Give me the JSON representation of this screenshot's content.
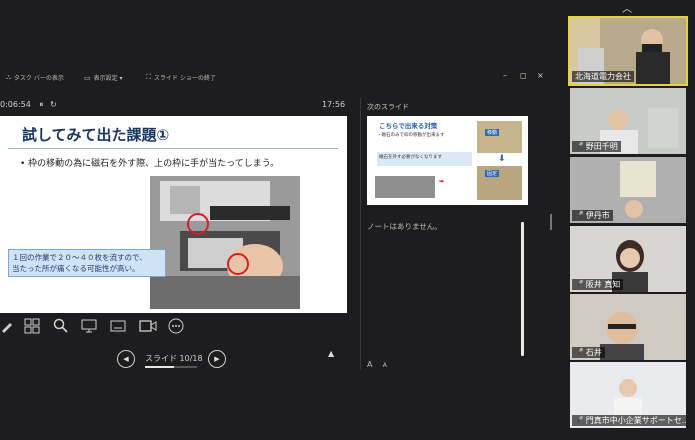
{
  "toolbar": {
    "taskbar_label": "タスク バーの表示",
    "display_settings_label": "表示設定 ▾",
    "end_show_label": "スライド ショーの終了",
    "win_min": "–",
    "win_restore": "◻",
    "win_close": "×"
  },
  "timer": {
    "elapsed_time": "0:06:54",
    "clock": "17:56"
  },
  "slide": {
    "title": "試してみて出た課題①",
    "bullet": "• 枠の移動の為に磁石を外す際、上の枠に手が当たってしまう。",
    "caption_line1": "１回の作業で２０～４０枚を流すので、",
    "caption_line2": "当たった所が痛くなる可能性が高い。"
  },
  "navigation": {
    "slide_indicator": "スライド 10/18",
    "current": 10,
    "total": 18
  },
  "next_slide": {
    "label": "次のスライド",
    "thumb_title": "こちらで出来る対策",
    "thumb_text1": "・磁石のみで枠の移動が出来ます",
    "thumb_text2": "磁石を外す必要がなくなります",
    "thumb_label1": "移動",
    "thumb_label2": "固定"
  },
  "notes": {
    "text": "ノートはありません。"
  },
  "font_controls": {
    "increase": "A",
    "decrease": "A"
  },
  "participants": [
    {
      "name": "北海道電力会社",
      "muted": false,
      "active": true
    },
    {
      "name": "野田千明",
      "muted": true,
      "active": false
    },
    {
      "name": "伊丹市",
      "muted": true,
      "active": false
    },
    {
      "name": "阪井 真知",
      "muted": true,
      "active": false
    },
    {
      "name": "石井",
      "muted": true,
      "active": false
    },
    {
      "name": "門真市中小企業サポートセ...",
      "muted": true,
      "active": false
    }
  ],
  "colors": {
    "accent_active": "#e2d53b",
    "slide_title": "#17375e",
    "mic_off": "#e74c3c"
  }
}
